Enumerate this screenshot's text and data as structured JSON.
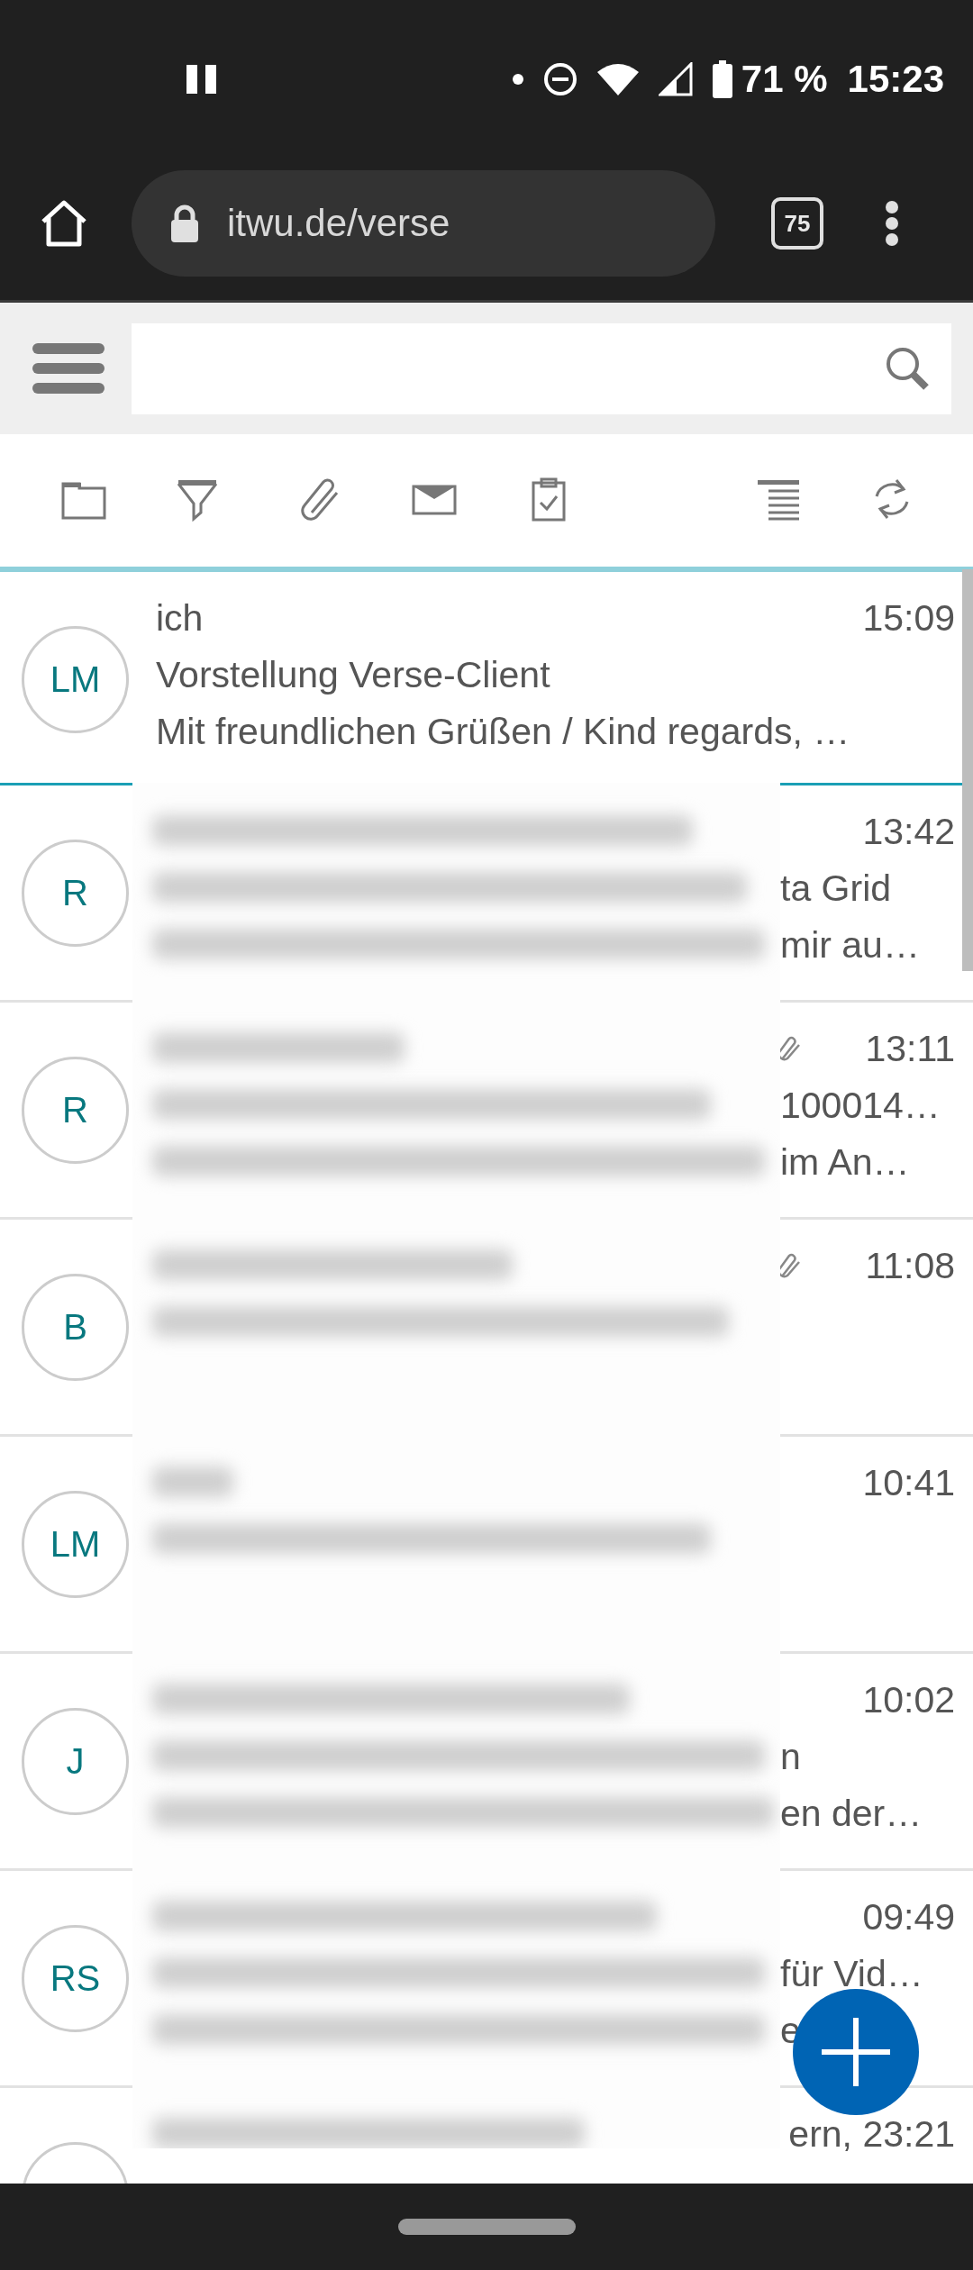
{
  "status_bar": {
    "battery": "71 %",
    "time": "15:23"
  },
  "browser": {
    "url": "itwu.de/verse",
    "tab_count": "75"
  },
  "privacy_blur": true,
  "messages": [
    {
      "avatar": "LM",
      "sender": "ich",
      "time": "15:09",
      "subject": "Vorstellung Verse-Client",
      "preview": "Mit freundlichen Grüßen / Kind regards, …",
      "selected": true,
      "blurred": false,
      "attachment": false
    },
    {
      "avatar": "R",
      "time": "13:42",
      "subject": "ta Grid",
      "preview": "mir au…",
      "selected": false,
      "blurred": true,
      "attachment": false
    },
    {
      "avatar": "R",
      "time": "13:11",
      "subject": "100014…",
      "preview": "im An…",
      "selected": false,
      "blurred": true,
      "attachment": true
    },
    {
      "avatar": "B",
      "time": "11:08",
      "selected": false,
      "attachment": true
    },
    {
      "avatar": "LM",
      "time": "10:41",
      "selected": false,
      "attachment": false
    },
    {
      "avatar": "J",
      "time": "10:02",
      "subject": "n",
      "preview": "en der…",
      "selected": false,
      "blurred": true,
      "attachment": false
    },
    {
      "avatar": "RS",
      "time": "09:49",
      "subject": "für Vid…",
      "preview": "e",
      "selected": false,
      "blurred": true,
      "attachment": false
    },
    {
      "time": "ern, 23:21",
      "selected": false,
      "attachment": false
    }
  ]
}
